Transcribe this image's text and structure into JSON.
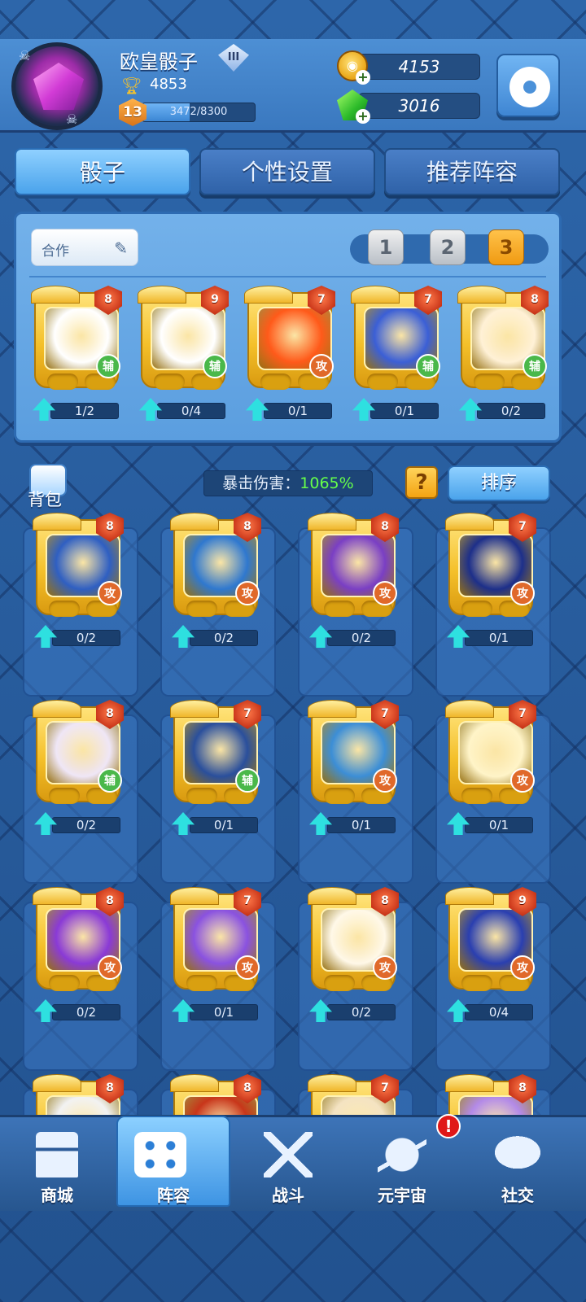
{
  "player": {
    "name": "欧皇骰子",
    "rank_label": "III",
    "trophies": "4853",
    "level": "13",
    "xp_text": "3472/8300",
    "xp_fraction": 0.418
  },
  "currency": {
    "coins": "4153",
    "gems": "3016"
  },
  "tabs": [
    {
      "label": "骰子",
      "active": true
    },
    {
      "label": "个性设置",
      "active": false
    },
    {
      "label": "推荐阵容",
      "active": false
    }
  ],
  "deck": {
    "name": "合作",
    "numbers": [
      "1",
      "2",
      "3"
    ],
    "active_number": "3",
    "cards": [
      {
        "level": "8",
        "role": "辅",
        "progress": "1/2",
        "art": "web",
        "color": "#ffffff"
      },
      {
        "level": "9",
        "role": "辅",
        "progress": "0/4",
        "art": "circle",
        "color": "#ffffff"
      },
      {
        "level": "7",
        "role": "攻",
        "progress": "0/1",
        "art": "fire",
        "color": "#ff5a1a"
      },
      {
        "level": "7",
        "role": "辅",
        "progress": "0/1",
        "art": "figure",
        "color": "#3b5fd6"
      },
      {
        "level": "8",
        "role": "辅",
        "progress": "0/2",
        "art": "cat",
        "color": "#fff1d6"
      }
    ]
  },
  "bag": {
    "label": "背包",
    "crit_label": "暴击伤害：",
    "crit_value": "1065%",
    "help_label": "?",
    "sort_label": "排序"
  },
  "collection": [
    {
      "level": "8",
      "role": "攻",
      "progress": "0/2",
      "art": "angel",
      "color": "#2f5fc2"
    },
    {
      "level": "8",
      "role": "攻",
      "progress": "0/2",
      "art": "aquarius",
      "color": "#2f78cf"
    },
    {
      "level": "8",
      "role": "攻",
      "progress": "0/2",
      "art": "archer",
      "color": "#7a3fc4"
    },
    {
      "level": "7",
      "role": "攻",
      "progress": "0/1",
      "art": "scorpion",
      "color": "#1d2f8a"
    },
    {
      "level": "8",
      "role": "辅",
      "progress": "0/2",
      "art": "witch",
      "color": "#efe6f6"
    },
    {
      "level": "7",
      "role": "辅",
      "progress": "0/1",
      "art": "dandelion",
      "color": "#2a4f9c"
    },
    {
      "level": "7",
      "role": "攻",
      "progress": "0/1",
      "art": "dragon",
      "color": "#3c8ed6"
    },
    {
      "level": "7",
      "role": "攻",
      "progress": "0/1",
      "art": "cross",
      "color": "#fff4c8"
    },
    {
      "level": "8",
      "role": "攻",
      "progress": "0/2",
      "art": "rays",
      "color": "#8a3ad6"
    },
    {
      "level": "7",
      "role": "攻",
      "progress": "0/1",
      "art": "ghost",
      "color": "#8a52e0"
    },
    {
      "level": "8",
      "role": "攻",
      "progress": "0/2",
      "art": "panda",
      "color": "#fff8e8"
    },
    {
      "level": "9",
      "role": "攻",
      "progress": "0/4",
      "art": "lotus",
      "color": "#2a3fb0"
    },
    {
      "level": "8",
      "role": "",
      "progress": "",
      "art": "taiji",
      "color": "#f2f2f2"
    },
    {
      "level": "8",
      "role": "",
      "progress": "",
      "art": "lava",
      "color": "#c8361a"
    },
    {
      "level": "7",
      "role": "",
      "progress": "",
      "art": "bird",
      "color": "#f4e3c2"
    },
    {
      "level": "8",
      "role": "",
      "progress": "",
      "art": "arrow",
      "color": "#b38ae8"
    }
  ],
  "nav": [
    {
      "label": "商城",
      "icon": "shop-icon",
      "active": false
    },
    {
      "label": "阵容",
      "icon": "dice-icon",
      "active": true
    },
    {
      "label": "战斗",
      "icon": "swords-icon",
      "active": false
    },
    {
      "label": "元宇宙",
      "icon": "planet-icon",
      "active": false,
      "alert": "!"
    },
    {
      "label": "社交",
      "icon": "chat-icon",
      "active": false
    }
  ],
  "colors": {
    "accent_blue": "#4aa3eb",
    "crit_green": "#66ff4a",
    "gold": "#f4c02a",
    "attack_orange": "#e0692a",
    "support_green": "#4ab84a"
  }
}
